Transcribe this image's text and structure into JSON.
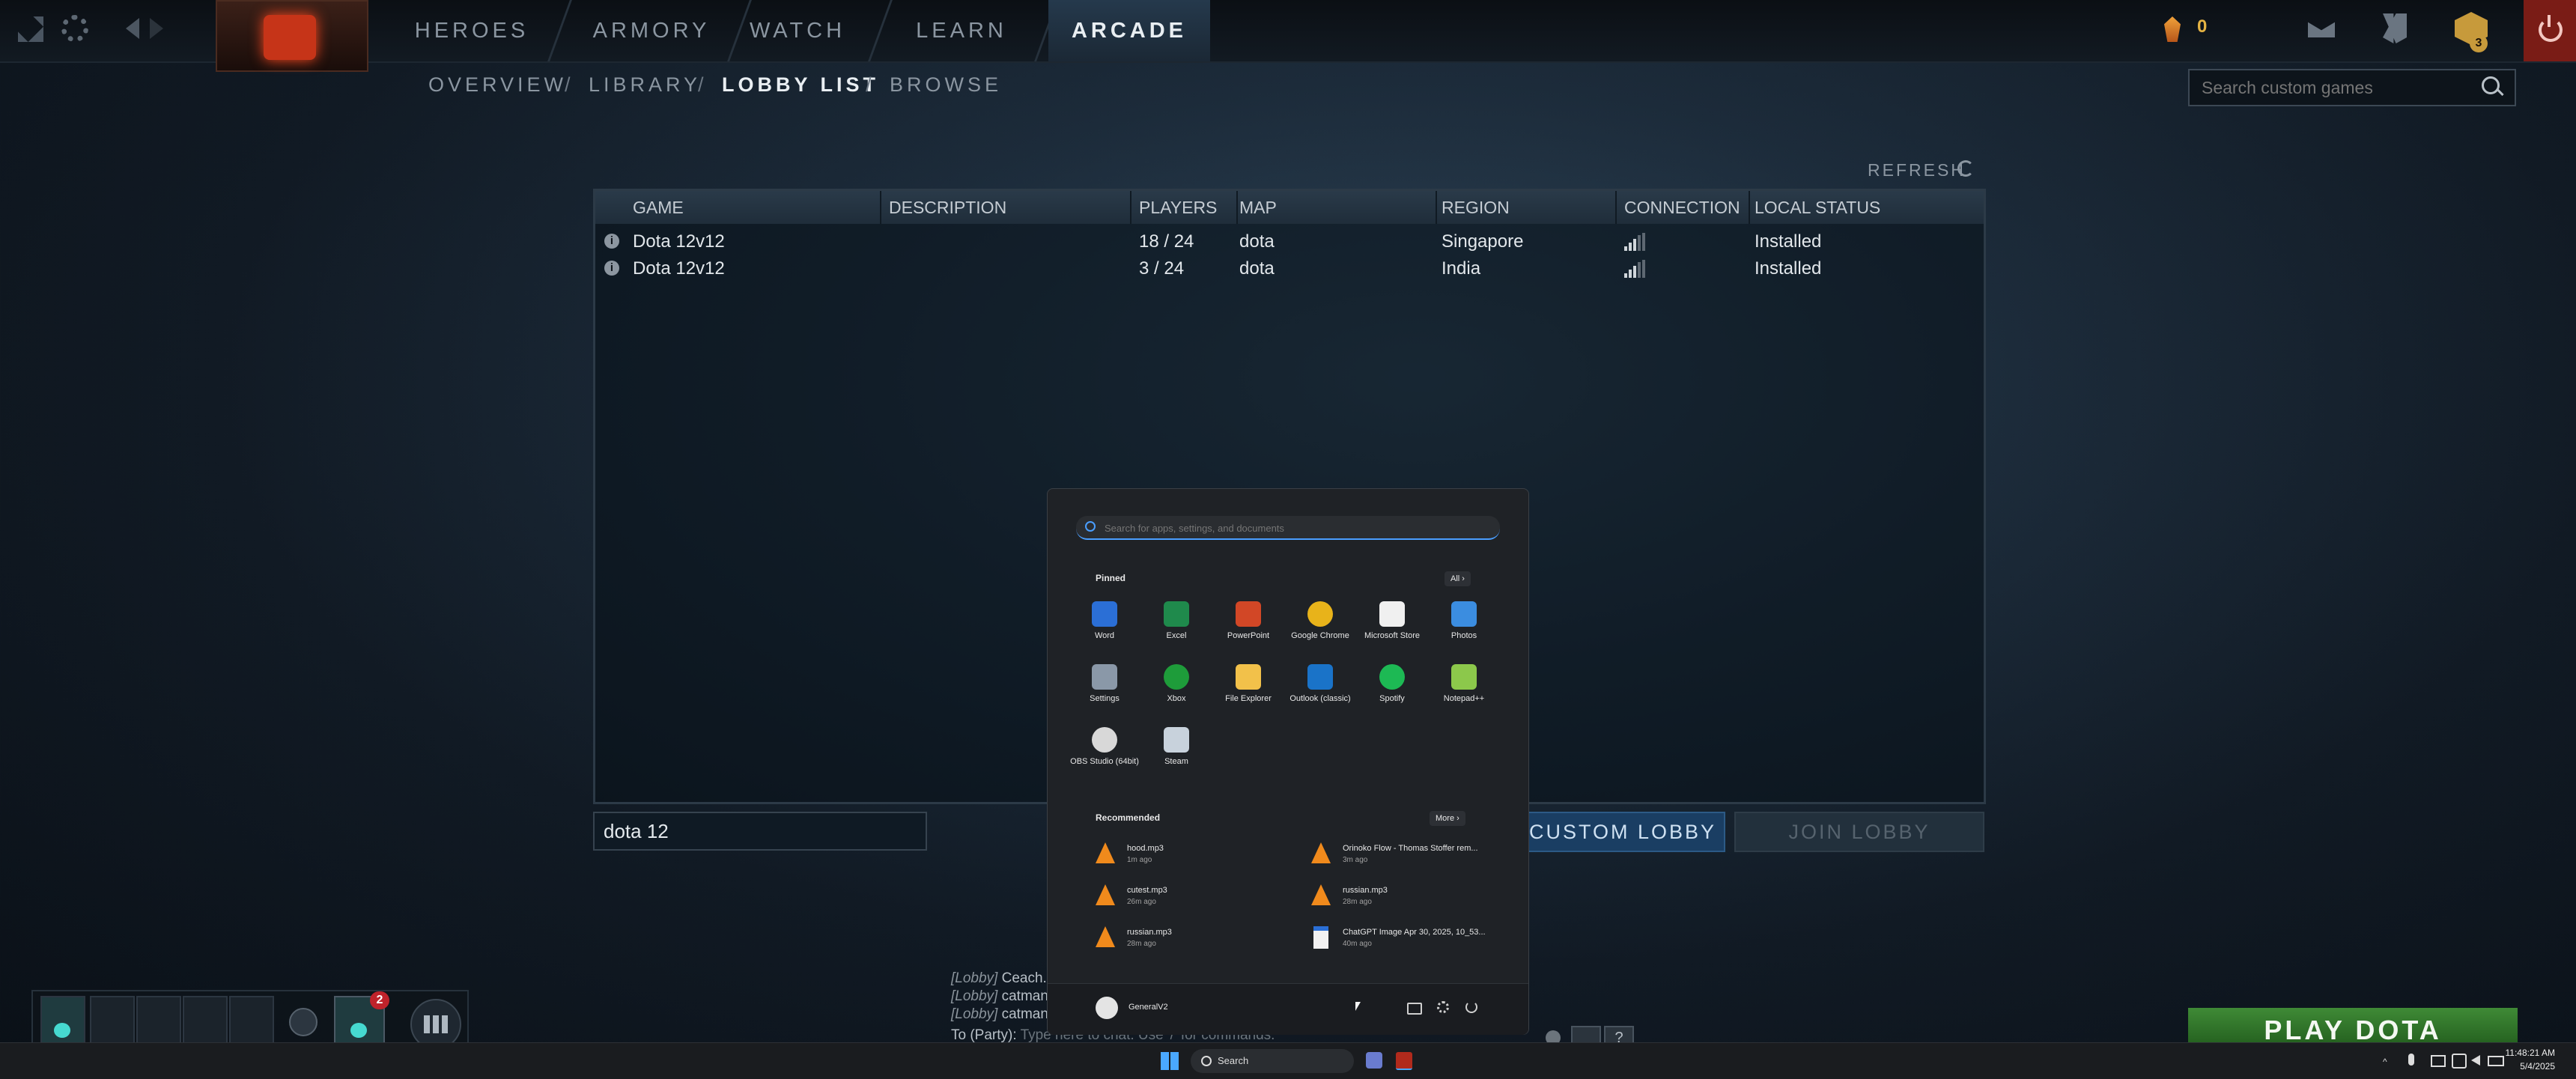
{
  "topnav": {
    "tabs": [
      "HEROES",
      "ARMORY",
      "WATCH",
      "LEARN",
      "ARCADE"
    ],
    "active_tab": "ARCADE",
    "currency_count": "0",
    "notif_badge": "3"
  },
  "subnav": {
    "items": [
      "OVERVIEW",
      "LIBRARY",
      "LOBBY LIST",
      "BROWSE"
    ],
    "active": "LOBBY LIST"
  },
  "search": {
    "placeholder": "Search custom games"
  },
  "refresh_label": "REFRESH",
  "table": {
    "columns": [
      "GAME",
      "DESCRIPTION",
      "PLAYERS",
      "MAP",
      "REGION",
      "CONNECTION",
      "LOCAL STATUS"
    ],
    "rows": [
      {
        "game": "Dota 12v12",
        "description": "",
        "players": "18 / 24",
        "map": "dota",
        "region": "Singapore",
        "local_status": "Installed"
      },
      {
        "game": "Dota 12v12",
        "description": "",
        "players": "3 / 24",
        "map": "dota",
        "region": "India",
        "local_status": "Installed"
      }
    ]
  },
  "filter": {
    "value": "dota 12"
  },
  "buttons": {
    "create": "CUSTOM LOBBY",
    "join": "JOIN LOBBY",
    "play": "PLAY DOTA"
  },
  "party": {
    "badge": "2"
  },
  "chat": {
    "lines": [
      {
        "tag": "[Lobby]",
        "name": "Ceach..."
      },
      {
        "tag": "[Lobby]",
        "name": "catman"
      },
      {
        "tag": "[Lobby]",
        "name": "catman"
      }
    ],
    "input_prefix": "To (Party):",
    "input_placeholder": "Type here to chat. Use '/' for commands."
  },
  "start_menu": {
    "search_placeholder": "Search for apps, settings, and documents",
    "pinned_label": "Pinned",
    "all_label": "All",
    "pinned": [
      {
        "name": "Word",
        "icon": "word-icon",
        "color": "#2b6fd6"
      },
      {
        "name": "Excel",
        "icon": "excel-icon",
        "color": "#1f8a4c"
      },
      {
        "name": "PowerPoint",
        "icon": "powerpoint-icon",
        "color": "#d24726"
      },
      {
        "name": "Google Chrome",
        "icon": "chrome-icon",
        "color": "#e8b31a"
      },
      {
        "name": "Microsoft Store",
        "icon": "store-icon",
        "color": "#f0f0f0"
      },
      {
        "name": "Photos",
        "icon": "photos-icon",
        "color": "#3b8de0"
      },
      {
        "name": "Settings",
        "icon": "settings-icon",
        "color": "#8a98a8"
      },
      {
        "name": "Xbox",
        "icon": "xbox-icon",
        "color": "#1e9c3a"
      },
      {
        "name": "File Explorer",
        "icon": "folder-icon",
        "color": "#f2c14a"
      },
      {
        "name": "Outlook (classic)",
        "icon": "outlook-icon",
        "color": "#1a73c8"
      },
      {
        "name": "Spotify",
        "icon": "spotify-icon",
        "color": "#1db954"
      },
      {
        "name": "Notepad++",
        "icon": "notepadpp-icon",
        "color": "#8cc84b"
      },
      {
        "name": "OBS Studio (64bit)",
        "icon": "obs-icon",
        "color": "#d8d8d8"
      },
      {
        "name": "Steam",
        "icon": "steam-icon",
        "color": "#c8d2dc"
      }
    ],
    "recommended_label": "Recommended",
    "more_label": "More",
    "recommended": [
      {
        "name": "hood.mp3",
        "time": "1m ago",
        "icon": "vlc-icon"
      },
      {
        "name": "Orinoko Flow - Thomas Stoffer rem...",
        "time": "3m ago",
        "icon": "vlc-icon"
      },
      {
        "name": "cutest.mp3",
        "time": "26m ago",
        "icon": "vlc-icon"
      },
      {
        "name": "russian.mp3",
        "time": "28m ago",
        "icon": "vlc-icon"
      },
      {
        "name": "russian.mp3",
        "time": "28m ago",
        "icon": "vlc-icon"
      },
      {
        "name": "ChatGPT Image Apr 30, 2025, 10_53...",
        "time": "40m ago",
        "icon": "image-file-icon"
      }
    ],
    "user": "GeneralV2"
  },
  "taskbar": {
    "search_label": "Search",
    "time": "11:48:21 AM",
    "date": "5/4/2025"
  },
  "colors": {
    "accent": "#4a9eff",
    "play_green": "#3f8a36",
    "brand_red": "#c63418"
  }
}
